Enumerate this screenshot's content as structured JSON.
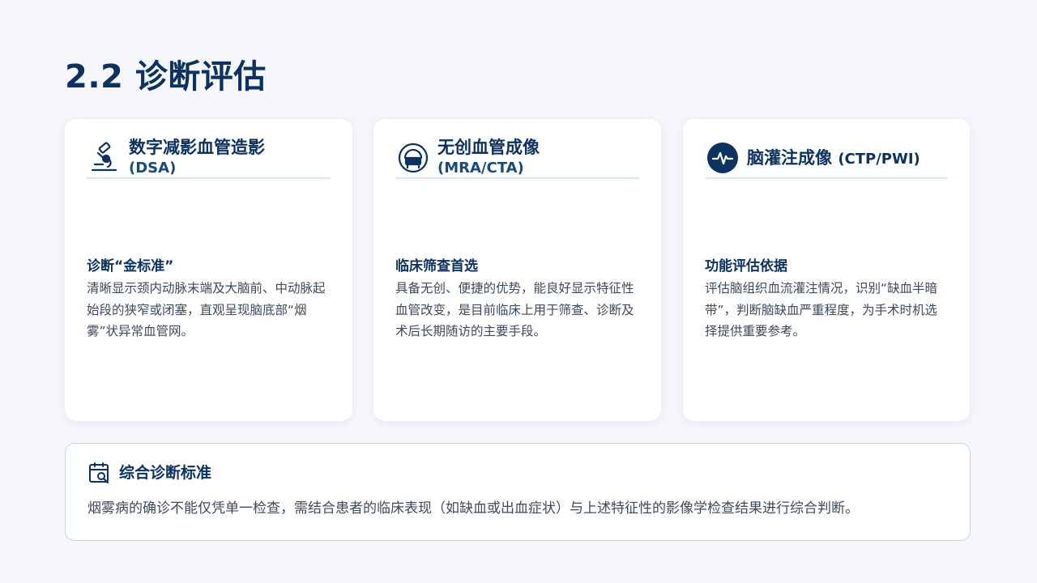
{
  "page": {
    "title": "2.2 诊断评估"
  },
  "cards": [
    {
      "icon": "microscope-icon",
      "title": "数字减影血管造影",
      "subtitle": "(DSA)",
      "body_title": "诊断“金标准”",
      "body_text": "清晰显示颈内动脉末端及大脑前、中动脉起始段的狭窄或闭塞，直观呈现脑底部“烟雾”状异常血管网。"
    },
    {
      "icon": "mri-scanner-icon",
      "title": "无创血管成像",
      "subtitle": "(MRA/CTA)",
      "body_title": "临床筛查首选",
      "body_text": "具备无创、便捷的优势，能良好显示特征性血管改变，是目前临床上用于筛查、诊断及术后长期随访的主要手段。"
    },
    {
      "icon": "pulse-wave-icon",
      "title": "脑灌注成像",
      "subtitle": "(CTP/PWI)",
      "body_title": "功能评估依据",
      "body_text": "评估脑组织血流灌注情况，识别“缺血半暗带”，判断脑缺血严重程度，为手术时机选择提供重要参考。"
    }
  ],
  "summary": {
    "icon": "calendar-search-icon",
    "title": "综合诊断标准",
    "text": "烟雾病的确诊不能仅凭单一检查，需结合患者的临床表现（如缺血或出血症状）与上述特征性的影像学检查结果进行综合判断。"
  },
  "colors": {
    "background": "#f4f6fa",
    "title": "#0d3260",
    "accent_line": "#d7e9f2",
    "summary_border": "#b9dde8",
    "body_text": "#3c4a5c"
  }
}
